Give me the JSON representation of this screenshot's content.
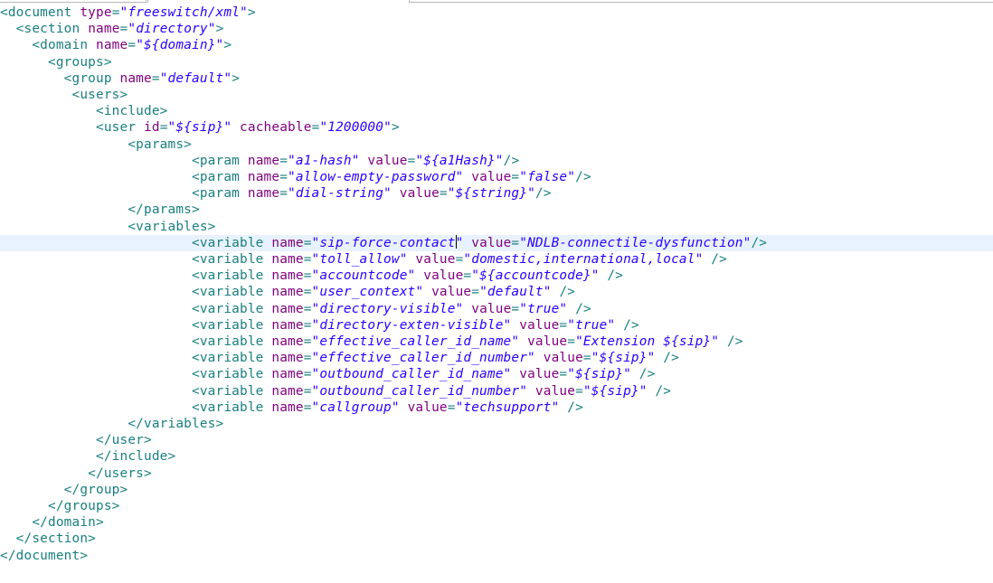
{
  "editor": {
    "lines": [
      [
        {
          "t": "tag",
          "v": "<document "
        },
        {
          "t": "attr",
          "v": "type"
        },
        {
          "t": "tag",
          "v": "="
        },
        {
          "t": "val",
          "v": "\"freeswitch/xml\""
        },
        {
          "t": "tag",
          "v": ">"
        }
      ],
      [
        {
          "t": "tag",
          "v": "  <section "
        },
        {
          "t": "attr",
          "v": "name"
        },
        {
          "t": "tag",
          "v": "="
        },
        {
          "t": "val",
          "v": "\"directory\""
        },
        {
          "t": "tag",
          "v": ">"
        }
      ],
      [
        {
          "t": "tag",
          "v": "    <domain "
        },
        {
          "t": "attr",
          "v": "name"
        },
        {
          "t": "tag",
          "v": "="
        },
        {
          "t": "val",
          "v": "\"${domain}\""
        },
        {
          "t": "tag",
          "v": ">"
        }
      ],
      [
        {
          "t": "tag",
          "v": "      <groups>"
        }
      ],
      [
        {
          "t": "tag",
          "v": "        <group "
        },
        {
          "t": "attr",
          "v": "name"
        },
        {
          "t": "tag",
          "v": "="
        },
        {
          "t": "val",
          "v": "\"default\""
        },
        {
          "t": "tag",
          "v": ">"
        }
      ],
      [
        {
          "t": "tag",
          "v": "         <users>"
        }
      ],
      [
        {
          "t": "tag",
          "v": "            <include>"
        }
      ],
      [
        {
          "t": "tag",
          "v": "            <user "
        },
        {
          "t": "attr",
          "v": "id"
        },
        {
          "t": "tag",
          "v": "="
        },
        {
          "t": "val",
          "v": "\"${sip}\""
        },
        {
          "t": "tag",
          "v": " "
        },
        {
          "t": "attr",
          "v": "cacheable"
        },
        {
          "t": "tag",
          "v": "="
        },
        {
          "t": "val",
          "v": "\"1200000\""
        },
        {
          "t": "tag",
          "v": ">"
        }
      ],
      [
        {
          "t": "tag",
          "v": "                <params>"
        }
      ],
      [
        {
          "t": "tag",
          "v": "                        <param "
        },
        {
          "t": "attr",
          "v": "name"
        },
        {
          "t": "tag",
          "v": "="
        },
        {
          "t": "val",
          "v": "\"a1-hash\""
        },
        {
          "t": "tag",
          "v": " "
        },
        {
          "t": "attr",
          "v": "value"
        },
        {
          "t": "tag",
          "v": "="
        },
        {
          "t": "val",
          "v": "\"${a1Hash}\""
        },
        {
          "t": "tag",
          "v": "/>"
        }
      ],
      [
        {
          "t": "tag",
          "v": "                        <param "
        },
        {
          "t": "attr",
          "v": "name"
        },
        {
          "t": "tag",
          "v": "="
        },
        {
          "t": "val",
          "v": "\"allow-empty-password\""
        },
        {
          "t": "tag",
          "v": " "
        },
        {
          "t": "attr",
          "v": "value"
        },
        {
          "t": "tag",
          "v": "="
        },
        {
          "t": "val",
          "v": "\"false\""
        },
        {
          "t": "tag",
          "v": "/>"
        }
      ],
      [
        {
          "t": "tag",
          "v": "                        <param "
        },
        {
          "t": "attr",
          "v": "name"
        },
        {
          "t": "tag",
          "v": "="
        },
        {
          "t": "val",
          "v": "\"dial-string\""
        },
        {
          "t": "tag",
          "v": " "
        },
        {
          "t": "attr",
          "v": "value"
        },
        {
          "t": "tag",
          "v": "="
        },
        {
          "t": "val",
          "v": "\"${string}\""
        },
        {
          "t": "tag",
          "v": "/>"
        }
      ],
      [
        {
          "t": "tag",
          "v": "                </params>"
        }
      ],
      [
        {
          "t": "tag",
          "v": "                <variables>"
        }
      ],
      [
        {
          "t": "tag",
          "v": "                        <variable "
        },
        {
          "t": "attr",
          "v": "name"
        },
        {
          "t": "tag",
          "v": "="
        },
        {
          "t": "val",
          "v": "\"sip-force-contact"
        },
        {
          "t": "cursor",
          "v": ""
        },
        {
          "t": "val",
          "v": "\""
        },
        {
          "t": "tag",
          "v": " "
        },
        {
          "t": "attr",
          "v": "value"
        },
        {
          "t": "tag",
          "v": "="
        },
        {
          "t": "val",
          "v": "\"NDLB-connectile-dysfunction\""
        },
        {
          "t": "tag",
          "v": "/>"
        }
      ],
      [
        {
          "t": "tag",
          "v": "                        <variable "
        },
        {
          "t": "attr",
          "v": "name"
        },
        {
          "t": "tag",
          "v": "="
        },
        {
          "t": "val",
          "v": "\"toll_allow\""
        },
        {
          "t": "tag",
          "v": " "
        },
        {
          "t": "attr",
          "v": "value"
        },
        {
          "t": "tag",
          "v": "="
        },
        {
          "t": "val",
          "v": "\"domestic,international,local\""
        },
        {
          "t": "tag",
          "v": " />"
        }
      ],
      [
        {
          "t": "tag",
          "v": "                        <variable "
        },
        {
          "t": "attr",
          "v": "name"
        },
        {
          "t": "tag",
          "v": "="
        },
        {
          "t": "val",
          "v": "\"accountcode\""
        },
        {
          "t": "tag",
          "v": " "
        },
        {
          "t": "attr",
          "v": "value"
        },
        {
          "t": "tag",
          "v": "="
        },
        {
          "t": "val",
          "v": "\"${accountcode}\""
        },
        {
          "t": "tag",
          "v": " />"
        }
      ],
      [
        {
          "t": "tag",
          "v": "                        <variable "
        },
        {
          "t": "attr",
          "v": "name"
        },
        {
          "t": "tag",
          "v": "="
        },
        {
          "t": "val",
          "v": "\"user_context\""
        },
        {
          "t": "tag",
          "v": " "
        },
        {
          "t": "attr",
          "v": "value"
        },
        {
          "t": "tag",
          "v": "="
        },
        {
          "t": "val",
          "v": "\"default\""
        },
        {
          "t": "tag",
          "v": " />"
        }
      ],
      [
        {
          "t": "tag",
          "v": "                        <variable "
        },
        {
          "t": "attr",
          "v": "name"
        },
        {
          "t": "tag",
          "v": "="
        },
        {
          "t": "val",
          "v": "\"directory-visible\""
        },
        {
          "t": "tag",
          "v": " "
        },
        {
          "t": "attr",
          "v": "value"
        },
        {
          "t": "tag",
          "v": "="
        },
        {
          "t": "val",
          "v": "\"true\""
        },
        {
          "t": "tag",
          "v": " />"
        }
      ],
      [
        {
          "t": "tag",
          "v": "                        <variable "
        },
        {
          "t": "attr",
          "v": "name"
        },
        {
          "t": "tag",
          "v": "="
        },
        {
          "t": "val",
          "v": "\"directory-exten-visible\""
        },
        {
          "t": "tag",
          "v": " "
        },
        {
          "t": "attr",
          "v": "value"
        },
        {
          "t": "tag",
          "v": "="
        },
        {
          "t": "val",
          "v": "\"true\""
        },
        {
          "t": "tag",
          "v": " />"
        }
      ],
      [
        {
          "t": "tag",
          "v": "                        <variable "
        },
        {
          "t": "attr",
          "v": "name"
        },
        {
          "t": "tag",
          "v": "="
        },
        {
          "t": "val",
          "v": "\"effective_caller_id_name\""
        },
        {
          "t": "tag",
          "v": " "
        },
        {
          "t": "attr",
          "v": "value"
        },
        {
          "t": "tag",
          "v": "="
        },
        {
          "t": "val",
          "v": "\"Extension ${sip}\""
        },
        {
          "t": "tag",
          "v": " />"
        }
      ],
      [
        {
          "t": "tag",
          "v": "                        <variable "
        },
        {
          "t": "attr",
          "v": "name"
        },
        {
          "t": "tag",
          "v": "="
        },
        {
          "t": "val",
          "v": "\"effective_caller_id_number\""
        },
        {
          "t": "tag",
          "v": " "
        },
        {
          "t": "attr",
          "v": "value"
        },
        {
          "t": "tag",
          "v": "="
        },
        {
          "t": "val",
          "v": "\"${sip}\""
        },
        {
          "t": "tag",
          "v": " />"
        }
      ],
      [
        {
          "t": "tag",
          "v": "                        <variable "
        },
        {
          "t": "attr",
          "v": "name"
        },
        {
          "t": "tag",
          "v": "="
        },
        {
          "t": "val",
          "v": "\"outbound_caller_id_name\""
        },
        {
          "t": "tag",
          "v": " "
        },
        {
          "t": "attr",
          "v": "value"
        },
        {
          "t": "tag",
          "v": "="
        },
        {
          "t": "val",
          "v": "\"${sip}\""
        },
        {
          "t": "tag",
          "v": " />"
        }
      ],
      [
        {
          "t": "tag",
          "v": "                        <variable "
        },
        {
          "t": "attr",
          "v": "name"
        },
        {
          "t": "tag",
          "v": "="
        },
        {
          "t": "val",
          "v": "\"outbound_caller_id_number\""
        },
        {
          "t": "tag",
          "v": " "
        },
        {
          "t": "attr",
          "v": "value"
        },
        {
          "t": "tag",
          "v": "="
        },
        {
          "t": "val",
          "v": "\"${sip}\""
        },
        {
          "t": "tag",
          "v": " />"
        }
      ],
      [
        {
          "t": "tag",
          "v": "                        <variable "
        },
        {
          "t": "attr",
          "v": "name"
        },
        {
          "t": "tag",
          "v": "="
        },
        {
          "t": "val",
          "v": "\"callgroup\""
        },
        {
          "t": "tag",
          "v": " "
        },
        {
          "t": "attr",
          "v": "value"
        },
        {
          "t": "tag",
          "v": "="
        },
        {
          "t": "val",
          "v": "\"techsupport\""
        },
        {
          "t": "tag",
          "v": " />"
        }
      ],
      [
        {
          "t": "tag",
          "v": "                </variables>"
        }
      ],
      [
        {
          "t": "tag",
          "v": "            </user>"
        }
      ],
      [
        {
          "t": "tag",
          "v": "            </include>"
        }
      ],
      [
        {
          "t": "tag",
          "v": "           </users>"
        }
      ],
      [
        {
          "t": "tag",
          "v": "        </group>"
        }
      ],
      [
        {
          "t": "tag",
          "v": "      </groups>"
        }
      ],
      [
        {
          "t": "tag",
          "v": "    </domain>"
        }
      ],
      [
        {
          "t": "tag",
          "v": "  </section>"
        }
      ],
      [
        {
          "t": "tag",
          "v": "</document>"
        }
      ]
    ],
    "current_line_index": 14,
    "colors": {
      "tag": "#1a7f7f",
      "attribute": "#7f007f",
      "value": "#2a00ff",
      "current_line_highlight": "#e8f2fe",
      "background": "#ffffff"
    }
  }
}
